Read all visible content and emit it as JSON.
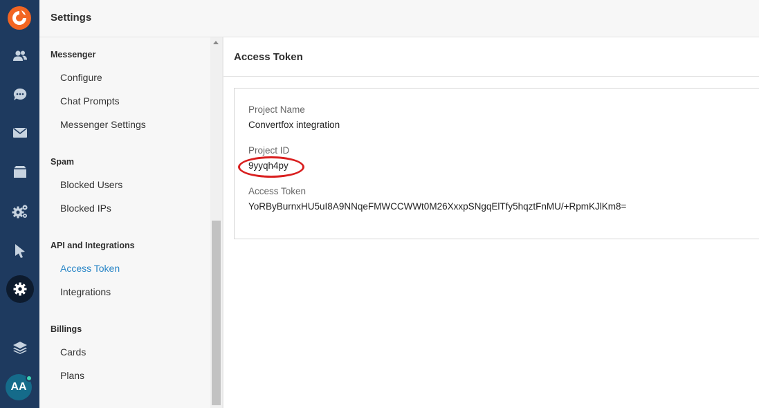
{
  "app": {
    "header_title": "Settings",
    "avatar_initials": "AA"
  },
  "rail": {
    "items": [
      {
        "icon": "users-icon"
      },
      {
        "icon": "chat-icon"
      },
      {
        "icon": "mail-icon"
      },
      {
        "icon": "inbox-icon"
      },
      {
        "icon": "gears-icon"
      },
      {
        "icon": "cursor-icon"
      },
      {
        "icon": "settings-icon",
        "active": true
      },
      {
        "icon": "layers-icon"
      }
    ],
    "colors": {
      "background": "#1e3a5f",
      "logo": "#f26522",
      "active": "#0d1b2e",
      "avatar": "#156b8a",
      "status_dot": "#3dd6b5"
    }
  },
  "nav": {
    "sections": [
      {
        "heading": "Messenger",
        "items": [
          "Configure",
          "Chat Prompts",
          "Messenger Settings"
        ]
      },
      {
        "heading": "Spam",
        "items": [
          "Blocked Users",
          "Blocked IPs"
        ]
      },
      {
        "heading": "API and Integrations",
        "items": [
          "Access Token",
          "Integrations"
        ]
      },
      {
        "heading": "Billings",
        "items": [
          "Cards",
          "Plans"
        ]
      }
    ],
    "active_item": "Access Token",
    "active_color": "#2a86c7"
  },
  "main": {
    "title": "Access Token",
    "fields": [
      {
        "label": "Project Name",
        "value": "Convertfox integration"
      },
      {
        "label": "Project ID",
        "value": "9yyqh4py"
      },
      {
        "label": "Access Token",
        "value": "YoRByBurnxHU5uI8A9NNqeFMWCCWWt0M26XxxpSNgqElTfy5hqztFnMU/+RpmKJlKm8="
      }
    ],
    "annotation_color": "#d92020"
  }
}
